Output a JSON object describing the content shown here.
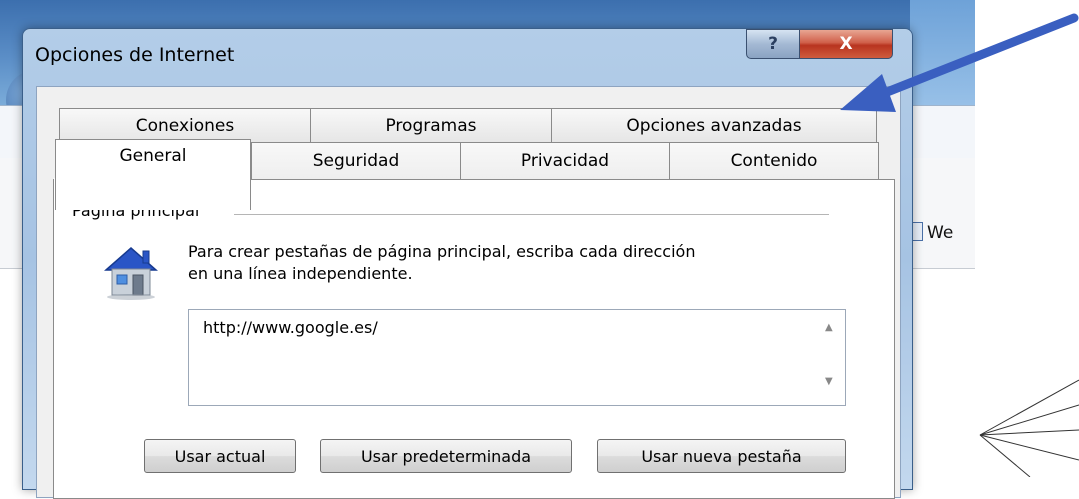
{
  "dialog": {
    "title": "Opciones de Internet",
    "help_label": "?",
    "close_label": "X"
  },
  "tabs": {
    "row_back": [
      {
        "label": "Conexiones"
      },
      {
        "label": "Programas"
      },
      {
        "label": "Opciones avanzadas"
      }
    ],
    "row_front": [
      {
        "label": "General",
        "active": true
      },
      {
        "label": "Seguridad"
      },
      {
        "label": "Privacidad"
      },
      {
        "label": "Contenido"
      }
    ]
  },
  "home_page": {
    "group_title": "Página principal",
    "description_line1": "Para crear pestañas de página principal, escriba cada dirección",
    "description_line2": "en una línea independiente.",
    "url_value": "http://www.google.es/",
    "buttons": {
      "use_current": "Usar actual",
      "use_default": "Usar predeterminada",
      "use_new_tab": "Usar nueva pestaña"
    }
  },
  "background": {
    "partial_link_text": "We"
  },
  "colors": {
    "annotation_arrow": "#3a5fc0"
  },
  "icons": {
    "home": "home-icon",
    "arrow": "annotation-arrow-icon"
  }
}
